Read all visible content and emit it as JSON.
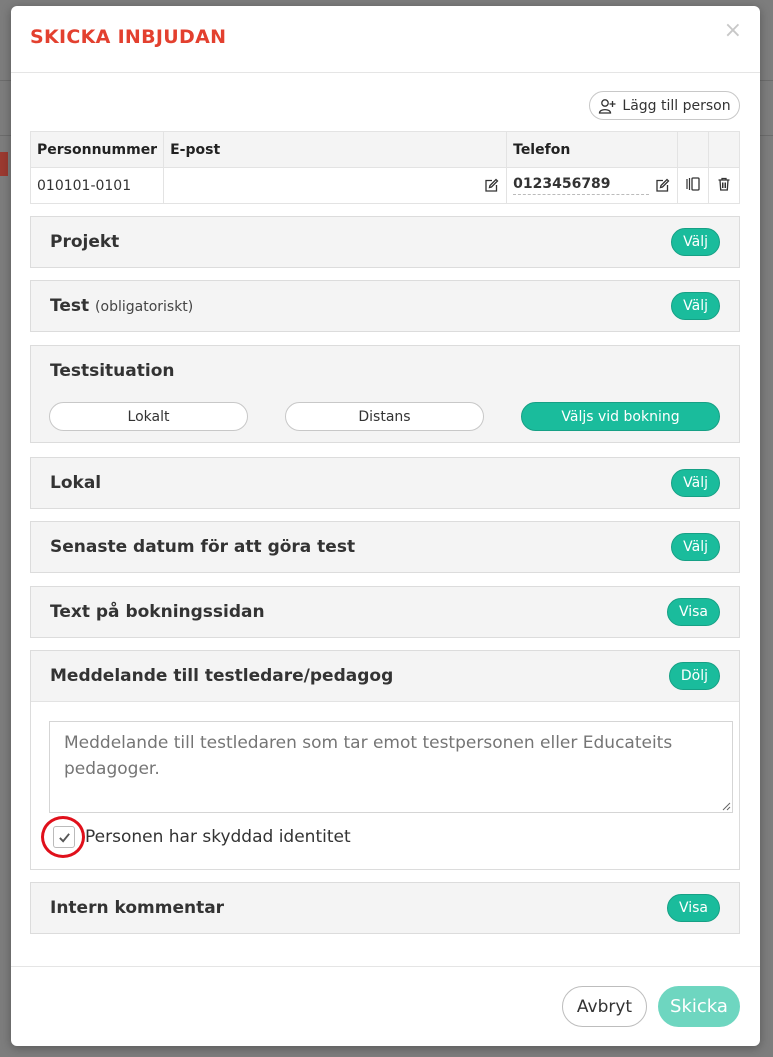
{
  "modal": {
    "title": "SKICKA INBJUDAN",
    "close": "×"
  },
  "add_person": {
    "label": "Lägg till person",
    "icon": "user-plus-icon"
  },
  "persons_table": {
    "headers": [
      "Personnummer",
      "E-post",
      "Telefon"
    ],
    "rows": [
      {
        "personnummer": "010101-0101",
        "email": "",
        "phone": "0123456789"
      }
    ]
  },
  "panels": {
    "projekt": {
      "title": "Projekt",
      "action": "Välj"
    },
    "test": {
      "title": "Test",
      "subtitle": "(obligatoriskt)",
      "action": "Välj"
    },
    "testsituation": {
      "title": "Testsituation",
      "options": [
        "Lokalt",
        "Distans",
        "Väljs vid bokning"
      ],
      "selected": "Väljs vid bokning"
    },
    "lokal": {
      "title": "Lokal",
      "action": "Välj"
    },
    "senaste_datum": {
      "title": "Senaste datum för att göra test",
      "action": "Välj"
    },
    "text_bokning": {
      "title": "Text på bokningssidan",
      "action": "Visa"
    },
    "meddelande": {
      "title": "Meddelande till testledare/pedagog",
      "action": "Dölj",
      "placeholder": "Meddelande till testledaren som tar emot testpersonen eller Educateits pedagoger.",
      "checkbox_label": "Personen har skyddad identitet",
      "checkbox_checked": true
    },
    "intern_kommentar": {
      "title": "Intern kommentar",
      "action": "Visa"
    }
  },
  "footer": {
    "cancel": "Avbryt",
    "send": "Skicka"
  },
  "colors": {
    "accent": "#1abc9c",
    "title": "#e3402f",
    "send_disabled": "#6ed6c0"
  }
}
